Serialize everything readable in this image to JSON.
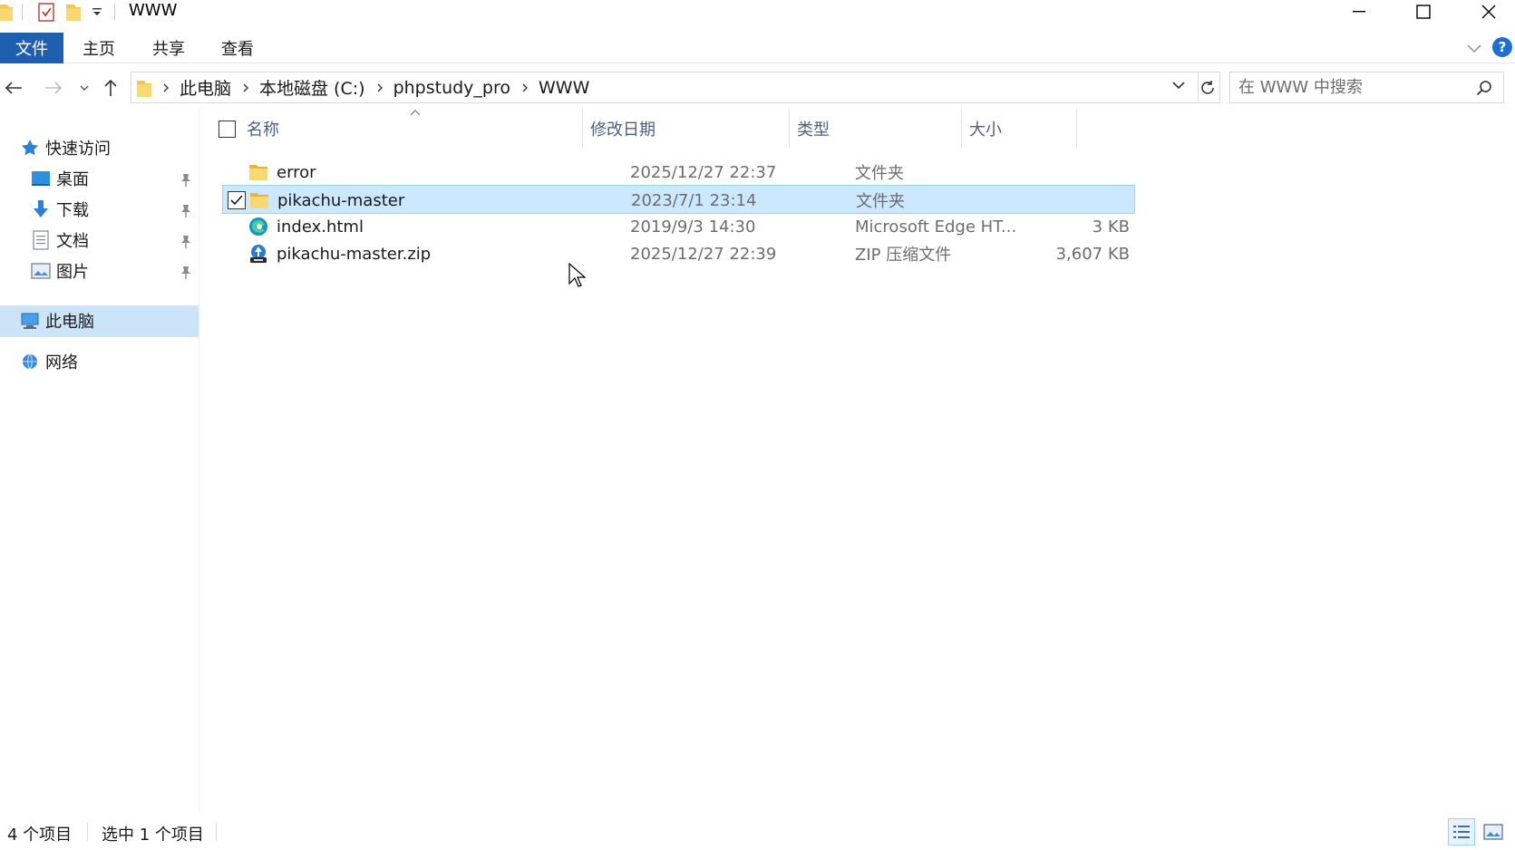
{
  "window": {
    "title": "WWW"
  },
  "ribbon": {
    "tabs": [
      "文件",
      "主页",
      "共享",
      "查看"
    ],
    "help_label": "?"
  },
  "address": {
    "breadcrumbs": [
      "此电脑",
      "本地磁盘 (C:)",
      "phpstudy_pro",
      "WWW"
    ]
  },
  "search": {
    "placeholder": "在 WWW 中搜索"
  },
  "sidebar": {
    "quick_access": "快速访问",
    "pinned": [
      {
        "label": "桌面",
        "icon": "desktop-icon"
      },
      {
        "label": "下载",
        "icon": "download-icon"
      },
      {
        "label": "文档",
        "icon": "documents-icon"
      },
      {
        "label": "图片",
        "icon": "pictures-icon"
      }
    ],
    "this_pc": "此电脑",
    "network": "网络"
  },
  "columns": {
    "name": "名称",
    "date": "修改日期",
    "type": "类型",
    "size": "大小"
  },
  "files": [
    {
      "name": "error",
      "date": "2025/12/27 22:37",
      "type": "文件夹",
      "size": "",
      "icon": "folder-icon",
      "selected": false
    },
    {
      "name": "pikachu-master",
      "date": "2023/7/1 23:14",
      "type": "文件夹",
      "size": "",
      "icon": "folder-icon",
      "selected": true
    },
    {
      "name": "index.html",
      "date": "2019/9/3 14:30",
      "type": "Microsoft Edge HT...",
      "size": "3 KB",
      "icon": "edge-html-icon",
      "selected": false
    },
    {
      "name": "pikachu-master.zip",
      "date": "2025/12/27 22:39",
      "type": "ZIP 压缩文件",
      "size": "3,607 KB",
      "icon": "zip-archive-icon",
      "selected": false
    }
  ],
  "status": {
    "item_count": "4 个项目",
    "selected_count": "选中 1 个项目"
  },
  "colors": {
    "accent": "#1f5fb0",
    "selection": "#cce8ff",
    "folder": "#f5c74a"
  }
}
